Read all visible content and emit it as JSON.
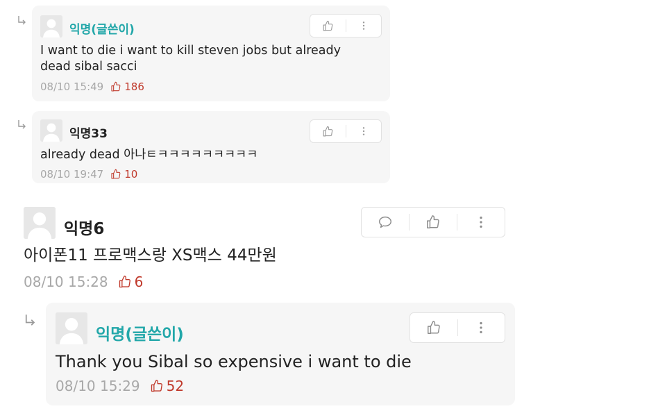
{
  "comments": [
    {
      "author": "익명(글쓴이)",
      "text": "I want to die i want to kill steven jobs but already dead sibal sacci",
      "time": "08/10 15:49",
      "likes": "186"
    },
    {
      "author": "익명33",
      "text": "already dead 아나ㅌㅋㅋㅋㅋㅋㅋㅋㅋㅋ",
      "time": "08/10 19:47",
      "likes": "10"
    },
    {
      "author": "익명6",
      "text": "아이폰11 프로맥스랑 XS맥스 44만원",
      "time": "08/10 15:28",
      "likes": "6"
    },
    {
      "author": "익명(글쓴이)",
      "text": "Thank you Sibal so expensive i want to die",
      "time": "08/10 15:29",
      "likes": "52"
    }
  ],
  "colors": {
    "author": "#22a7a9",
    "likes": "#c0392b",
    "meta": "#a8a8a8",
    "bubble": "#f6f6f6"
  },
  "icons": [
    "reply-arrow-icon",
    "avatar-icon",
    "thumbs-up-icon",
    "more-vertical-icon",
    "comment-icon"
  ]
}
